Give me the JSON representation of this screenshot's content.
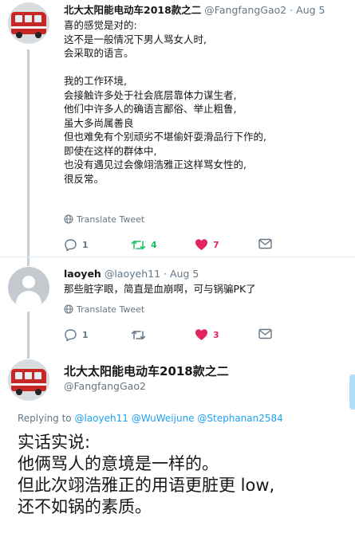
{
  "tweet1": {
    "display_name": "北大太阳能电动车2018款之二",
    "handle": "@FangfangGao2",
    "separator": "·",
    "date": "Aug 5",
    "lines": [
      "喜的感觉是对的:",
      "这不是一般情况下男人骂女人时,",
      "会采取的语言。",
      "",
      "我的工作环境,",
      "会接触许多处于社会底层靠体力谋生者,",
      "他们中许多人的确语言鄙俗、举止粗鲁,",
      "虽大多尚属善良",
      "但也难免有个别顽劣不堪偷奸耍滑品行下作的,",
      "即使在这样的群体中,",
      "也没有遇见过会像翊浩雅正这样骂女性的,",
      "很反常。"
    ],
    "translate_label": "Translate Tweet",
    "reply_count": "1",
    "retweet_count": "4",
    "like_count": "7"
  },
  "tweet2": {
    "display_name": "laoyeh",
    "handle": "@laoyeh11",
    "separator": "·",
    "date": "Aug 5",
    "text": "那些脏字眼，简直是血崩啊，可与锅骗PK了",
    "translate_label": "Translate Tweet",
    "reply_count": "1",
    "retweet_count": "",
    "like_count": "3"
  },
  "main_tweet": {
    "display_name": "北大太阳能电动车2018款之二",
    "handle": "@FangfangGao2",
    "replying_prefix": "Replying to",
    "mentions": [
      "@laoyeh11",
      "@WuWeijune",
      "@Stephanan2584"
    ],
    "lines": [
      "实话实说:",
      "他俩骂人的意境是一样的。",
      "但此次翊浩雅正的用语更脏更 low,",
      "还不如锅的素质。"
    ]
  },
  "colors": {
    "text": "#14171a",
    "secondary": "#657786",
    "link": "#1da1f2",
    "retweet": "#17bf63",
    "like": "#e0245e",
    "thread_line": "#c6d0d8"
  },
  "icons": {
    "reply": "reply-icon",
    "retweet": "retweet-icon",
    "like": "heart-icon",
    "dm": "envelope-icon",
    "translate": "globe-icon"
  }
}
